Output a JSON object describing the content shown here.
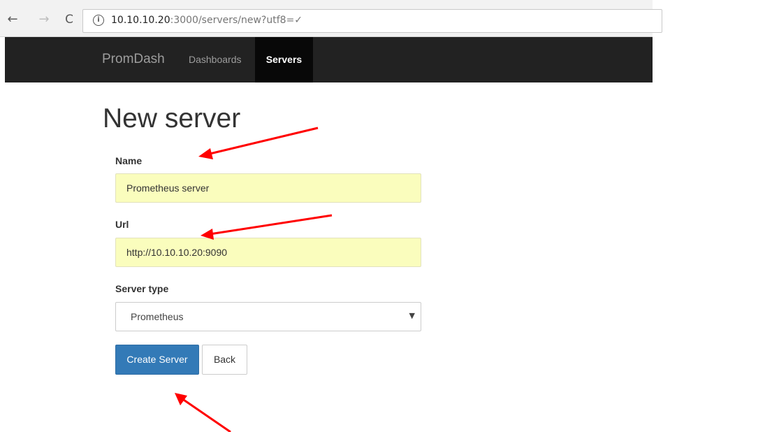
{
  "browser": {
    "back_glyph": "←",
    "forward_glyph": "→",
    "reload_glyph": "C",
    "info_glyph": "i",
    "url_host": "10.10.10.20",
    "url_path": ":3000/servers/new?utf8=✓"
  },
  "navbar": {
    "brand": "PromDash",
    "links": [
      {
        "label": "Dashboards",
        "active": false
      },
      {
        "label": "Servers",
        "active": true
      }
    ]
  },
  "page": {
    "title": "New server"
  },
  "form": {
    "name_label": "Name",
    "name_value": "Prometheus server",
    "url_label": "Url",
    "url_value": "http://10.10.10.20:9090",
    "server_type_label": "Server type",
    "server_type_value": "Prometheus",
    "select_caret": "▼",
    "submit_label": "Create Server",
    "back_label": "Back"
  },
  "annotation_color": "#ff0000",
  "colors": {
    "navbar_bg": "#222222",
    "active_nav_bg": "#080808",
    "primary_button": "#337ab7",
    "autofill_bg": "#fafdbd"
  }
}
